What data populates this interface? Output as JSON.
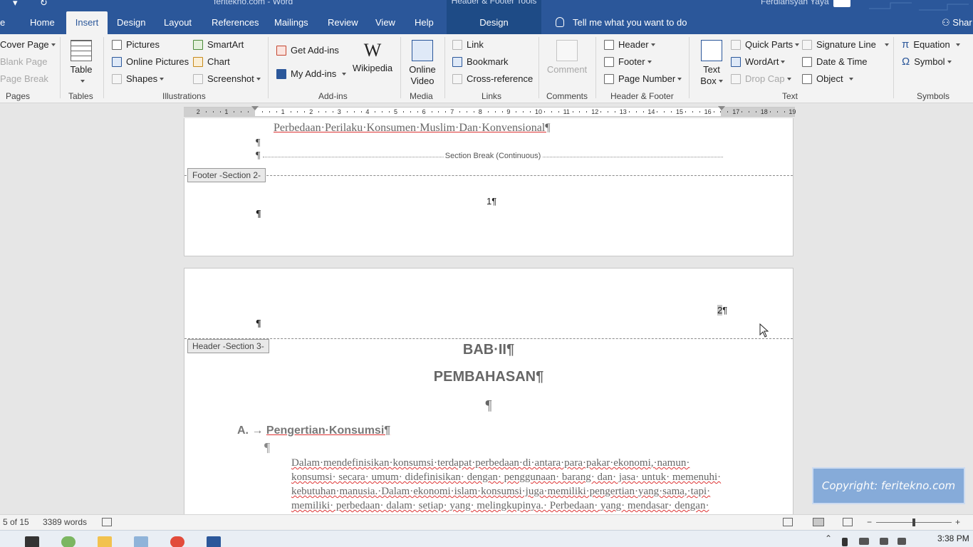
{
  "titlebar": {
    "document_name": "feritekno.com",
    "app_name": "Word",
    "context_title": "Header & Footer Tools",
    "user_name": "Ferdiansyah Yaya"
  },
  "tabs": {
    "file_partial": "e",
    "home": "Home",
    "insert": "Insert",
    "design": "Design",
    "layout": "Layout",
    "references": "References",
    "mailings": "Mailings",
    "review": "Review",
    "view": "View",
    "help": "Help",
    "context_design": "Design",
    "tell_me": "Tell me what you want to do",
    "share": "Shar"
  },
  "ribbon": {
    "pages": {
      "cover_page": "Cover Page",
      "blank_page": "Blank Page",
      "page_break": "Page Break",
      "label": "Pages"
    },
    "tables": {
      "table": "Table",
      "label": "Tables"
    },
    "illustrations": {
      "pictures": "Pictures",
      "online_pictures": "Online Pictures",
      "shapes": "Shapes",
      "smartart": "SmartArt",
      "chart": "Chart",
      "screenshot": "Screenshot",
      "label": "Illustrations"
    },
    "addins": {
      "get_addins": "Get Add-ins",
      "my_addins": "My Add-ins",
      "wikipedia": "Wikipedia",
      "wiki_glyph": "W",
      "label": "Add-ins"
    },
    "media": {
      "online_video_1": "Online",
      "online_video_2": "Video",
      "label": "Media"
    },
    "links": {
      "link": "Link",
      "bookmark": "Bookmark",
      "cross_reference": "Cross-reference",
      "label": "Links"
    },
    "comments": {
      "comment": "Comment",
      "label": "Comments"
    },
    "header_footer": {
      "header": "Header",
      "footer": "Footer",
      "page_number": "Page Number",
      "label": "Header & Footer"
    },
    "text": {
      "text_box_1": "Text",
      "text_box_2": "Box",
      "quick_parts": "Quick Parts",
      "wordart": "WordArt",
      "drop_cap": "Drop Cap",
      "signature_line": "Signature Line",
      "date_time": "Date & Time",
      "object": "Object",
      "label": "Text"
    },
    "symbols": {
      "equation": "Equation",
      "symbol": "Symbol",
      "equation_glyph": "π",
      "symbol_glyph": "Ω",
      "label": "Symbols"
    }
  },
  "ruler": {
    "left_labels": [
      "2",
      "1"
    ],
    "right_labels": [
      "1",
      "2",
      "3",
      "4",
      "5",
      "6",
      "7",
      "8",
      "9",
      "10",
      "11",
      "12",
      "13",
      "14",
      "15",
      "16",
      "17",
      "18",
      "19"
    ]
  },
  "document": {
    "pilcrow": "¶",
    "page1": {
      "title_line": "Perbedaan·Perilaku·Konsumen·Muslim·Dan·Konvensional¶",
      "section_break": "Section Break (Continuous)",
      "footer_tag": "Footer -Section 2-",
      "page_number": "1¶"
    },
    "page2": {
      "page_number_digit": "2",
      "page_number_mark": "¶",
      "header_tag": "Header -Section 3-",
      "chapter": "BAB·II¶",
      "chapter_title": "PEMBAHASAN¶",
      "section_num": "A. →",
      "section_title": "Pengertian·Konsumsi¶",
      "body_lines": [
        "Dalam·mendefinisikan·konsumsi·terdapat·perbedaan·di·antara·para·pakar·ekonomi,·namun·",
        "konsumsi· secara· umum· didefinisikan· dengan· penggunaan· barang· dan· jasa· untuk· memenuhi·",
        "kebutuhan·manusia.·Dalam·ekonomi·islam·konsumsi·juga·memiliki·pengertian·yang·sama,·tapi·",
        "memiliki· perbedaan· dalam· setiap· yang· melingkupinya.· Perbedaan· yang· mendasar· dengan·"
      ]
    }
  },
  "watermark": "Copyright: feritekno.com",
  "statusbar": {
    "page_info": "5 of 15",
    "word_count": "3389 words",
    "zoom_minus": "−",
    "zoom_plus": "+"
  },
  "taskbar": {
    "time": "3:38 PM"
  },
  "colors": {
    "ribbon_blue": "#2b579a",
    "context_tab": "#1e4b86",
    "ribbon_bg": "#f3f3f3",
    "watermark": "#7ea7d8",
    "spelling_underline": "#d33"
  }
}
